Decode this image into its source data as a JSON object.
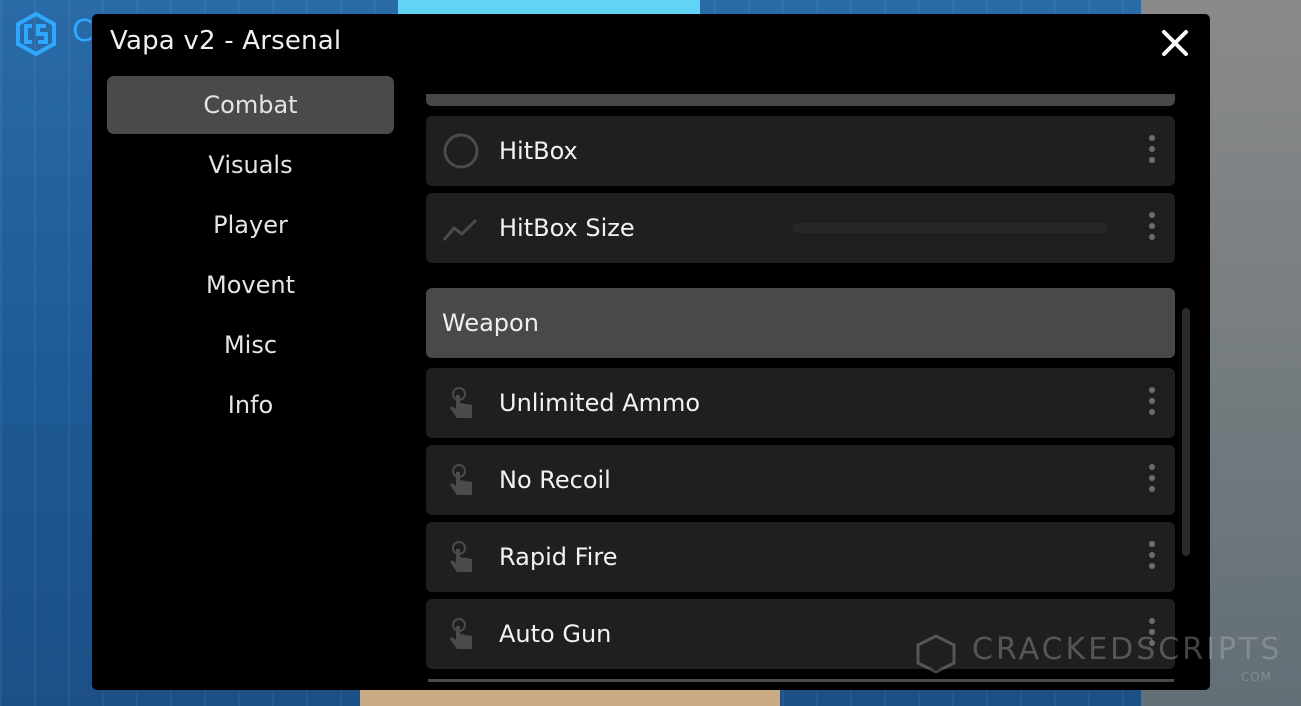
{
  "window": {
    "title": "Vapa v2 - Arsenal",
    "close_icon": "close-icon"
  },
  "corner_logo_letter": "C",
  "sidebar": {
    "items": [
      {
        "label": "Combat",
        "active": true
      },
      {
        "label": "Visuals"
      },
      {
        "label": "Player"
      },
      {
        "label": "Movent"
      },
      {
        "label": "Misc"
      },
      {
        "label": "Info"
      }
    ]
  },
  "main": {
    "rows_top": [
      {
        "label": "HitBox",
        "icon": "toggle-circle-icon"
      },
      {
        "label": "HitBox Size",
        "icon": "slider-graph-icon"
      }
    ],
    "section_title": "Weapon",
    "rows_weapon": [
      {
        "label": "Unlimited Ammo",
        "icon": "tap-hand-icon"
      },
      {
        "label": "No Recoil",
        "icon": "tap-hand-icon"
      },
      {
        "label": "Rapid Fire",
        "icon": "tap-hand-icon"
      },
      {
        "label": "Auto Gun",
        "icon": "tap-hand-icon"
      }
    ]
  },
  "watermark": {
    "text": "CRACKEDSCRIPTS",
    "sub": ".COM"
  },
  "colors": {
    "window_bg": "#000000",
    "row_bg": "#1f1f1f",
    "active_bg": "#4a4a4a",
    "section_bg": "#494949"
  }
}
